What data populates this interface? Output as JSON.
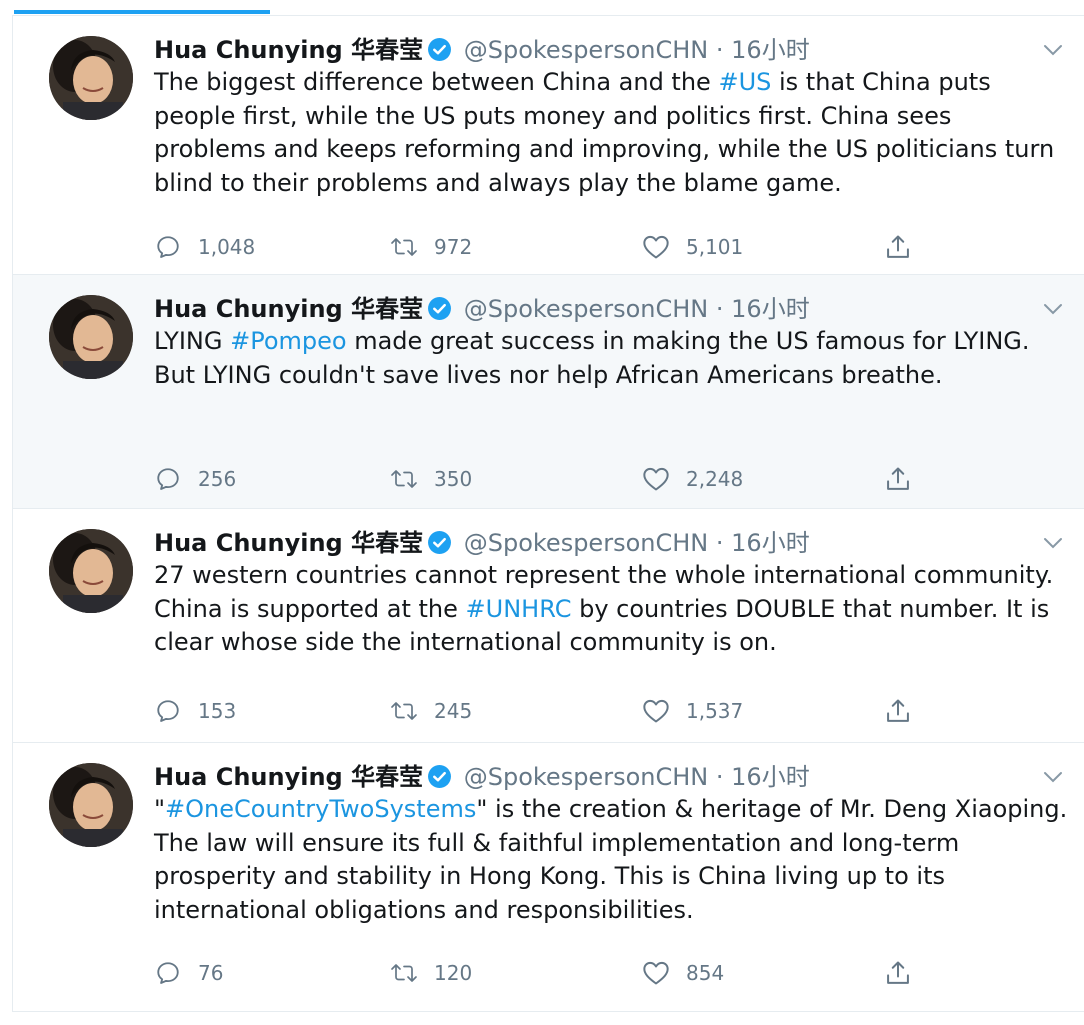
{
  "tweets": [
    {
      "name": "Hua Chunying 华春莹",
      "handle": "@SpokespersonCHN",
      "separator": "·",
      "time": "16小时",
      "text_before": "The biggest difference between China and the ",
      "hashtag": "#US",
      "text_after": " is that China puts people first, while the US puts money and politics first. China sees problems and keeps reforming and improving, while the US politicians turn blind to their problems and always play the blame game.",
      "replies": "1,048",
      "retweets": "972",
      "likes": "5,101"
    },
    {
      "name": "Hua Chunying 华春莹",
      "handle": "@SpokespersonCHN",
      "separator": "·",
      "time": "16小时",
      "text_before": "LYING ",
      "hashtag": "#Pompeo",
      "text_after": " made great success in making the US famous for LYING. But LYING couldn't save lives nor help African Americans breathe.",
      "replies": "256",
      "retweets": "350",
      "likes": "2,248"
    },
    {
      "name": "Hua Chunying 华春莹",
      "handle": "@SpokespersonCHN",
      "separator": "·",
      "time": "16小时",
      "text_before": "27 western countries cannot represent the whole international community. China is supported at the ",
      "hashtag": "#UNHRC",
      "text_after": " by countries DOUBLE that number. It is clear whose side the international community is on.",
      "replies": "153",
      "retweets": "245",
      "likes": "1,537"
    },
    {
      "name": "Hua Chunying 华春莹",
      "handle": "@SpokespersonCHN",
      "separator": "·",
      "time": "16小时",
      "text_before": "\"",
      "hashtag": "#OneCountryTwoSystems",
      "text_after": "\" is the creation & heritage of Mr. Deng Xiaoping. The law will ensure its full & faithful implementation and long-term prosperity and stability in Hong Kong. This is China living up to its international obligations and responsibilities.",
      "replies": "76",
      "retweets": "120",
      "likes": "854"
    }
  ],
  "colors": {
    "accent": "#1da1f2",
    "hashtag": "#1b95e0",
    "muted": "#657786",
    "hover_background": "#f5f8fa"
  },
  "icons": [
    "reply-icon",
    "retweet-icon",
    "like-icon",
    "share-icon",
    "verified-badge-icon",
    "chevron-down-icon"
  ]
}
